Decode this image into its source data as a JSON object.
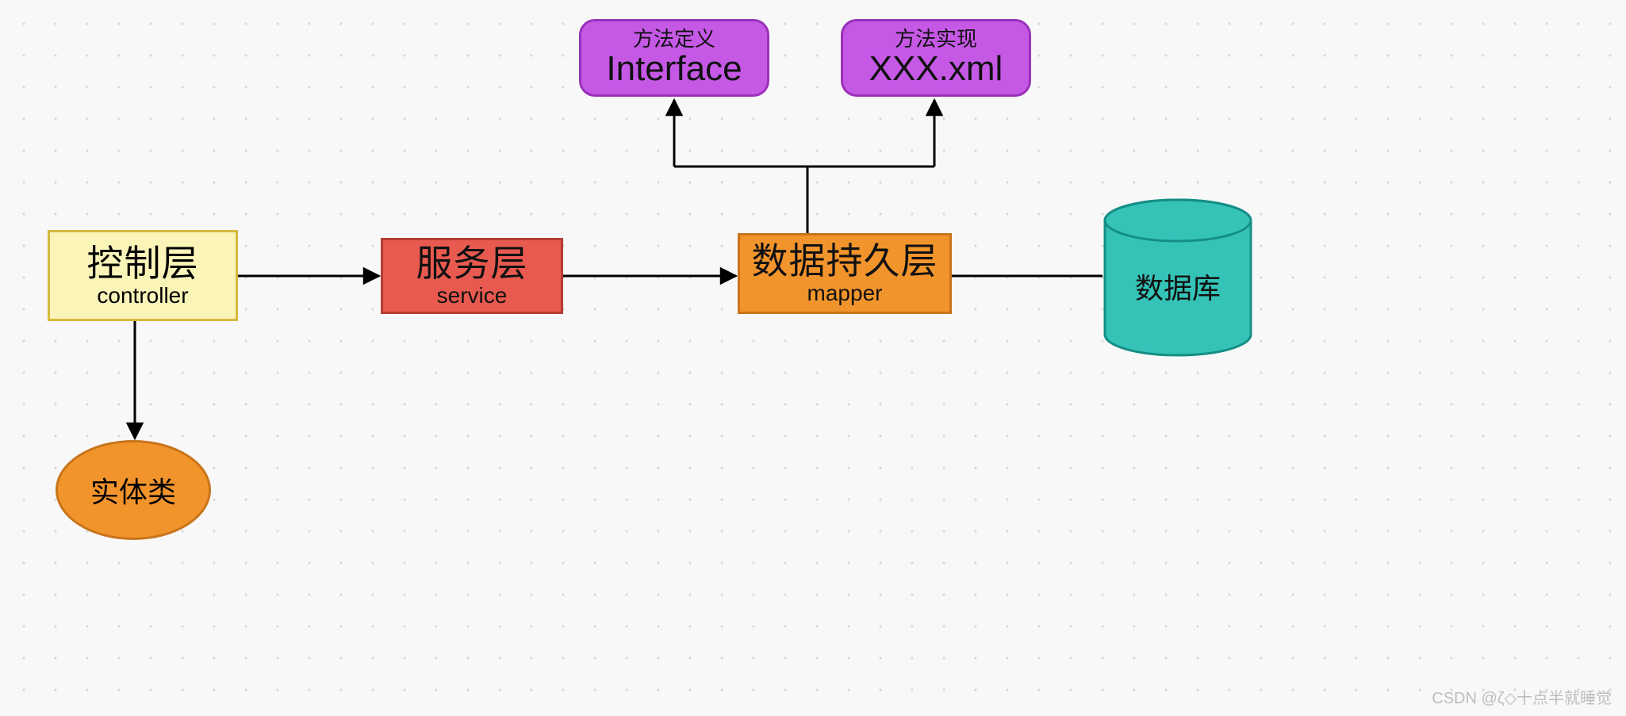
{
  "nodes": {
    "controller": {
      "title": "控制层",
      "sub": "controller"
    },
    "service": {
      "title": "服务层",
      "sub": "service"
    },
    "mapper": {
      "title": "数据持久层",
      "sub": "mapper"
    },
    "interface": {
      "small": "方法定义",
      "large": "Interface"
    },
    "xml": {
      "small": "方法实现",
      "large": "XXX.xml"
    },
    "entity": {
      "label": "实体类"
    },
    "database": {
      "label": "数据库"
    }
  },
  "edges": [
    {
      "from": "controller",
      "to": "service",
      "type": "arrow"
    },
    {
      "from": "service",
      "to": "mapper",
      "type": "arrow"
    },
    {
      "from": "mapper",
      "to": "database",
      "type": "line"
    },
    {
      "from": "controller",
      "to": "entity",
      "type": "arrow-down"
    },
    {
      "from": "mapper",
      "to": "interface",
      "type": "branch-up"
    },
    {
      "from": "mapper",
      "to": "xml",
      "type": "branch-up"
    }
  ],
  "colors": {
    "controller_fill": "#fbf4b9",
    "controller_stroke": "#d6b93c",
    "service_fill": "#e85a4f",
    "service_stroke": "#b53d32",
    "mapper_fill": "#f2942c",
    "mapper_stroke": "#c8741a",
    "purple_fill": "#c658e6",
    "purple_stroke": "#9a31b9",
    "db_fill": "#35c3b8",
    "db_stroke": "#158e85",
    "arrow": "#000000"
  },
  "watermark": "CSDN @ζ◇十点半就睡觉"
}
